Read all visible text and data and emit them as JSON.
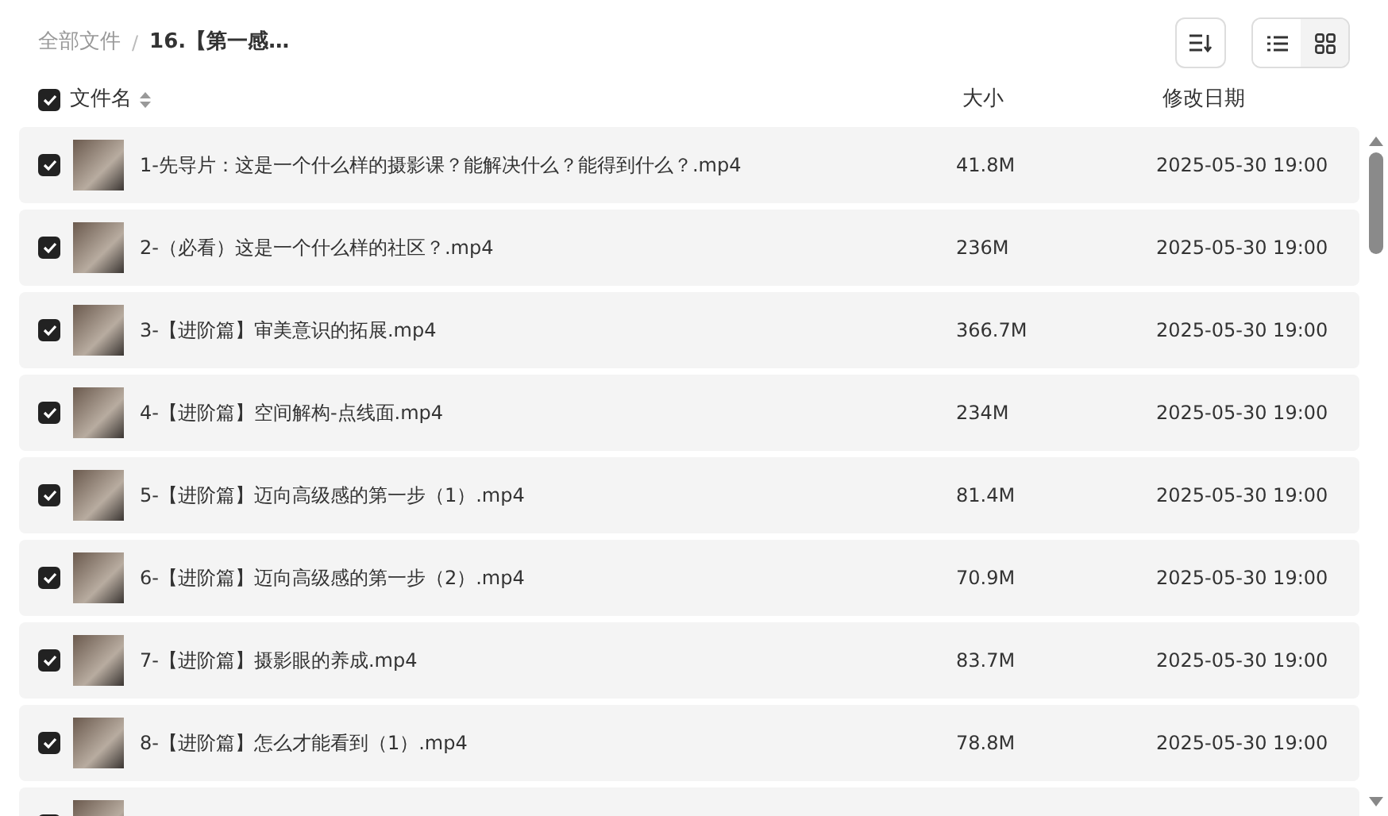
{
  "breadcrumb_separator": "/",
  "breadcrumb": [
    {
      "label": "全部文件",
      "current": false
    },
    {
      "label": "16.【第一感…",
      "current": true
    }
  ],
  "view_toggle": [
    {
      "kind": "list",
      "selected": true
    },
    {
      "kind": "grid",
      "selected": false
    }
  ],
  "header": {
    "checked": true,
    "columns": [
      "文件名",
      "大小",
      "修改日期"
    ]
  },
  "files": [
    {
      "checked": true,
      "name": "1-先导片：这是一个什么样的摄影课？能解决什么？能得到什么？.mp4",
      "size": "41.8M",
      "modified": "2025-05-30 19:00"
    },
    {
      "checked": true,
      "name": "2-（必看）这是一个什么样的社区？.mp4",
      "size": "236M",
      "modified": "2025-05-30 19:00"
    },
    {
      "checked": true,
      "name": "3-【进阶篇】审美意识的拓展.mp4",
      "size": "366.7M",
      "modified": "2025-05-30 19:00"
    },
    {
      "checked": true,
      "name": "4-【进阶篇】空间解构-点线面.mp4",
      "size": "234M",
      "modified": "2025-05-30 19:00"
    },
    {
      "checked": true,
      "name": "5-【进阶篇】迈向高级感的第一步（1）.mp4",
      "size": "81.4M",
      "modified": "2025-05-30 19:00"
    },
    {
      "checked": true,
      "name": "6-【进阶篇】迈向高级感的第一步（2）.mp4",
      "size": "70.9M",
      "modified": "2025-05-30 19:00"
    },
    {
      "checked": true,
      "name": "7-【进阶篇】摄影眼的养成.mp4",
      "size": "83.7M",
      "modified": "2025-05-30 19:00"
    },
    {
      "checked": true,
      "name": "8-【进阶篇】怎么才能看到（1）.mp4",
      "size": "78.8M",
      "modified": "2025-05-30 19:00"
    },
    {
      "checked": true
    }
  ]
}
